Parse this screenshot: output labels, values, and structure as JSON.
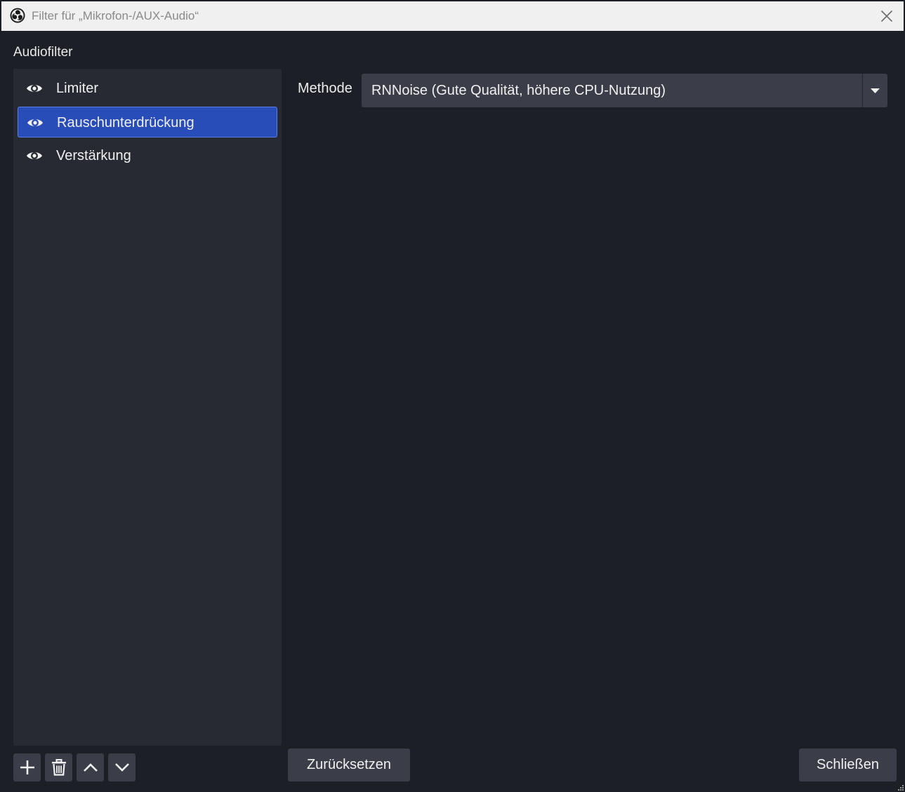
{
  "window": {
    "title": "Filter für „Mikrofon-/AUX-Audio“"
  },
  "section_label": "Audiofilter",
  "filters": [
    {
      "label": "Limiter",
      "selected": false
    },
    {
      "label": "Rauschunterdrückung",
      "selected": true
    },
    {
      "label": "Verstärkung",
      "selected": false
    }
  ],
  "toolbar": {
    "add_icon": "plus-icon",
    "remove_icon": "trash-icon",
    "up_icon": "chevron-up-icon",
    "down_icon": "chevron-down-icon"
  },
  "properties": {
    "method_label": "Methode",
    "method_value": "RNNoise (Gute Qualität, höhere CPU-Nutzung)"
  },
  "buttons": {
    "reset": "Zurücksetzen",
    "close": "Schließen"
  },
  "colors": {
    "background": "#1d1f26",
    "panel": "#272a33",
    "selection": "#284cb8",
    "control": "#3b3e48"
  }
}
